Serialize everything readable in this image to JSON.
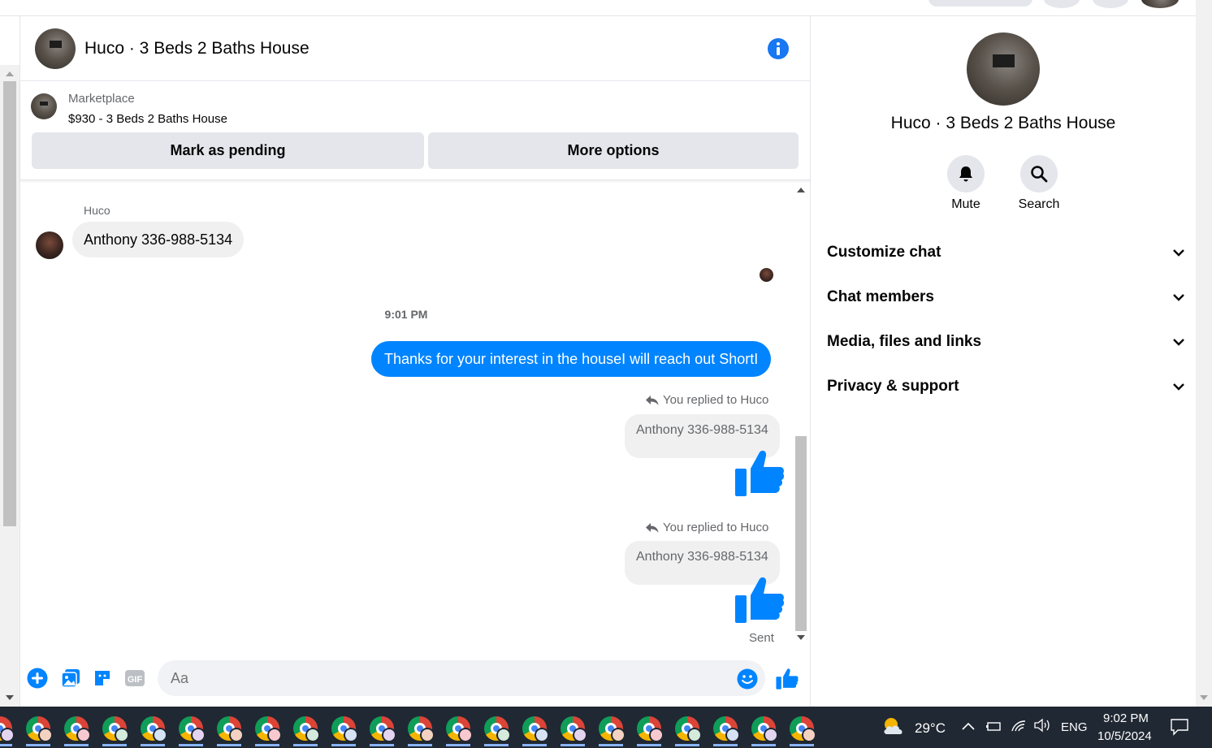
{
  "header": {
    "title": "Huco · 3 Beds 2 Baths House"
  },
  "marketplace": {
    "label": "Marketplace",
    "listing": "$930 - 3 Beds 2 Baths House",
    "pending_button": "Mark as pending",
    "more_button": "More options"
  },
  "messages": {
    "sender_name": "Huco",
    "incoming_text": "Anthony 336-988-5134",
    "timestamp": "9:01 PM",
    "outgoing_text": "Thanks for your interest in the houseI will reach out ShortI",
    "reply1": {
      "label": "You replied to Huco",
      "quoted": "Anthony 336-988-5134"
    },
    "reply2": {
      "label": "You replied to Huco",
      "quoted": "Anthony 336-988-5134"
    },
    "status": "Sent"
  },
  "composer": {
    "placeholder": "Aa",
    "icons": [
      "plus-icon",
      "photo-icon",
      "sticker-icon",
      "gif-icon",
      "emoji-icon",
      "like-icon"
    ]
  },
  "sidebar": {
    "title": "Huco · 3 Beds 2 Baths House",
    "mute_label": "Mute",
    "search_label": "Search",
    "sections": [
      {
        "label": "Customize chat"
      },
      {
        "label": "Chat members"
      },
      {
        "label": "Media, files and links"
      },
      {
        "label": "Privacy & support"
      }
    ]
  },
  "taskbar": {
    "temperature": "29°C",
    "language": "ENG",
    "time": "9:02 PM",
    "date": "10/5/2024"
  },
  "colors": {
    "messenger_blue": "#0084ff",
    "info_blue": "#1877f2",
    "taskbar_bg": "#202833"
  }
}
